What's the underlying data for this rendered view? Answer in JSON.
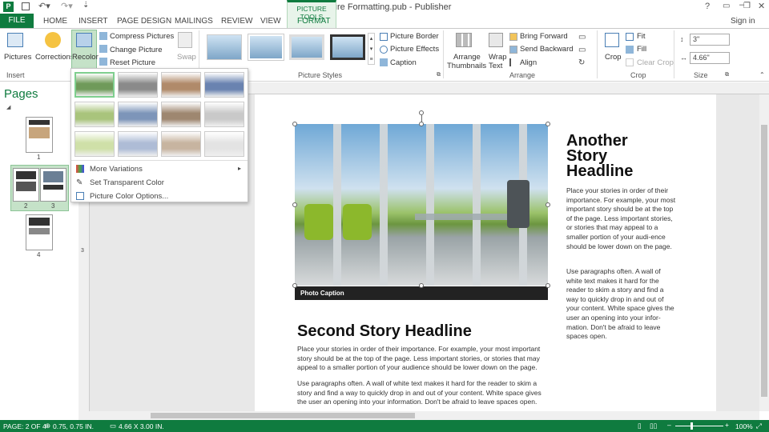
{
  "title": "Picture Formatting.pub - Publisher",
  "context_tab": "PICTURE TOOLS",
  "tabs": [
    "FILE",
    "HOME",
    "INSERT",
    "PAGE DESIGN",
    "MAILINGS",
    "REVIEW",
    "VIEW",
    "FORMAT"
  ],
  "signin": "Sign in",
  "ribbon": {
    "pictures": "Pictures",
    "corrections": "Corrections",
    "recolor": "Recolor",
    "compress": "Compress Pictures",
    "change": "Change Picture",
    "reset": "Reset Picture",
    "swap": "Swap",
    "picture_border": "Picture Border",
    "picture_effects": "Picture Effects",
    "caption": "Caption",
    "arrange1": "Arrange",
    "arrange2": "Thumbnails",
    "wrap1": "Wrap",
    "wrap2": "Text",
    "bring_forward": "Bring Forward",
    "send_backward": "Send Backward",
    "align": "Align",
    "crop": "Crop",
    "fit": "Fit",
    "fill": "Fill",
    "clear_crop": "Clear Crop",
    "height": "3\"",
    "width": "4.66\""
  },
  "groups": {
    "insert": "Insert",
    "picture_styles": "Picture Styles",
    "arrange": "Arrange",
    "crop": "Crop",
    "size": "Size"
  },
  "pages_title": "Pages",
  "thumb_labels": [
    "1",
    "2",
    "3",
    "4"
  ],
  "menu": {
    "more_variations": "More Variations",
    "set_transparent": "Set Transparent Color",
    "color_options": "Picture Color Options..."
  },
  "swatches": [
    [
      "#6f9a5a",
      "#8a8a8a",
      "#b08a6a",
      "#6a83b0"
    ],
    [
      "#a9c47c",
      "#7d95b9",
      "#9e8770",
      "#c9c9c9"
    ],
    [
      "#cfe0a8",
      "#aebcd6",
      "#c7b4a0",
      "#e3e3e3"
    ]
  ],
  "doc": {
    "headline": "Another Story Headline",
    "side1": "Place your stories in order of their importance. For example, your most important story should be at the top of the page. Less important stories, or stories that may appeal to a smaller portion of your audi-ence should be lower down on the page.",
    "side2": "Use paragraphs often. A wall of white text makes it hard for the reader to skim a story and find a way to quickly drop in and out of your content. White space gives the user an opening into your infor-mation. Don't be afraid to leave spaces open.",
    "caption": "Photo Caption",
    "headline2": "Second Story Headline",
    "body1": "Place your stories in order of their importance. For example, your most important story should be at the top of the page. Less important stories, or stories that may appeal to a smaller portion of your audience should be lower down on the page.",
    "body2": "Use paragraphs often. A wall of white text makes it hard for the reader to skim a story and find a way to quickly drop in and out of your content. White space gives the user an opening into your information. Don't be afraid to leave spaces open."
  },
  "status": {
    "page": "PAGE: 2 OF 4",
    "pos": "0.75, 0.75 IN.",
    "size": "4.66 X 3.00 IN.",
    "zoom": "100%"
  },
  "ruler_marks": [
    "1",
    "2",
    "3"
  ],
  "colors": {
    "accent": "#0f7b3f",
    "ribbon_sel": "#c5e2c8"
  }
}
